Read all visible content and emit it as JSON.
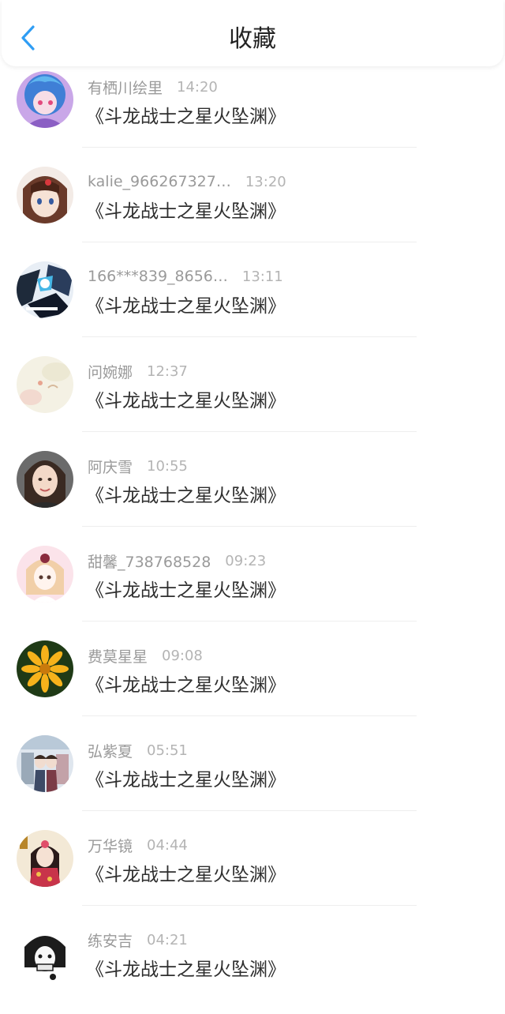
{
  "header": {
    "title": "收藏",
    "back_icon": "chevron-left-icon",
    "accent_color": "#2f9df4"
  },
  "items": [
    {
      "name": "有栖川绘里",
      "time": "14:20",
      "work": "《斗龙战士之星火坠渊》"
    },
    {
      "name": "kalie_966267327…",
      "time": "13:20",
      "work": "《斗龙战士之星火坠渊》"
    },
    {
      "name": "166***839_8656…",
      "time": "13:11",
      "work": "《斗龙战士之星火坠渊》"
    },
    {
      "name": "问婉娜",
      "time": "12:37",
      "work": "《斗龙战士之星火坠渊》"
    },
    {
      "name": "阿庆雪",
      "time": "10:55",
      "work": "《斗龙战士之星火坠渊》"
    },
    {
      "name": "甜馨_738768528",
      "time": "09:23",
      "work": "《斗龙战士之星火坠渊》"
    },
    {
      "name": "费莫星星",
      "time": "09:08",
      "work": "《斗龙战士之星火坠渊》"
    },
    {
      "name": "弘紫夏",
      "time": "05:51",
      "work": "《斗龙战士之星火坠渊》"
    },
    {
      "name": "万华镜",
      "time": "04:44",
      "work": "《斗龙战士之星火坠渊》"
    },
    {
      "name": "练安吉",
      "time": "04:21",
      "work": "《斗龙战士之星火坠渊》"
    }
  ]
}
